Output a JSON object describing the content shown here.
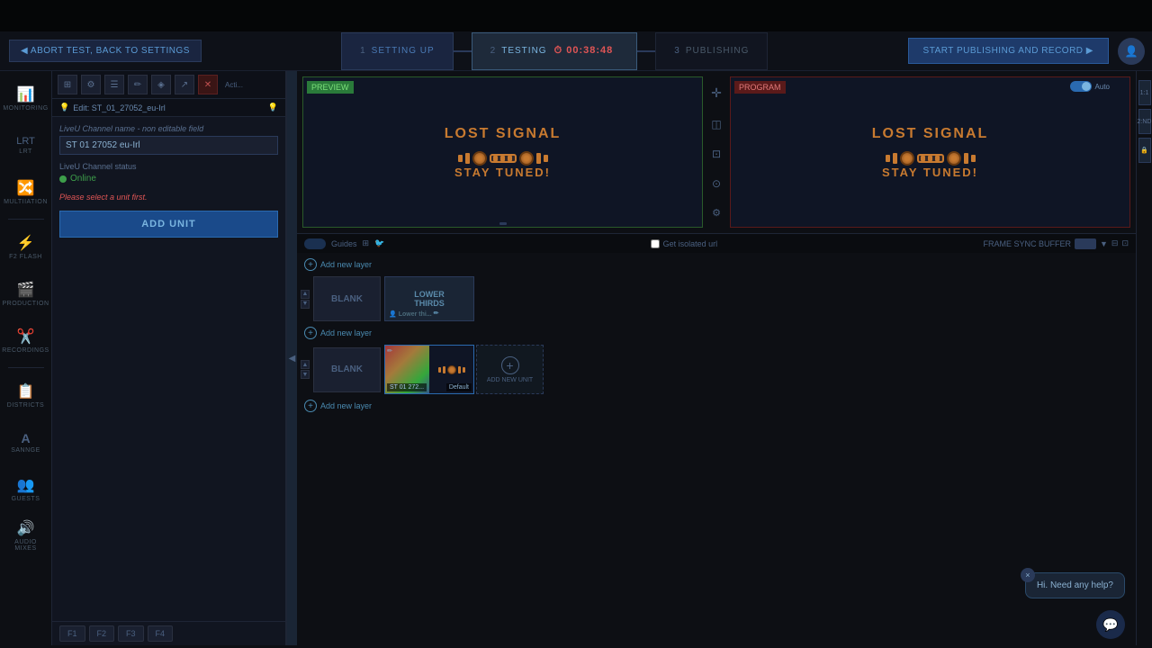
{
  "topBar": {
    "empty": ""
  },
  "header": {
    "abortBtn": "◀ ABORT TEST, BACK TO SETTINGS",
    "step1Num": "1",
    "step1Label": "SETTING UP",
    "step2Num": "2",
    "step2Label": "TESTING",
    "timer": "⏱ 00:38:48",
    "step3Num": "3",
    "step3Label": "PUBLISHING",
    "publishBtn": "START PUBLISHING AND RECORD ▶"
  },
  "sidebar": {
    "items": [
      {
        "label": "MONITORING",
        "icon": "📊"
      },
      {
        "label": "LRT",
        "icon": "📡"
      },
      {
        "label": "MULTIIATION",
        "icon": "🔀"
      },
      {
        "label": "F2 FLASH",
        "icon": "⚡"
      },
      {
        "label": "PRODUCTION",
        "icon": "🎬"
      },
      {
        "label": "RECORDINGS",
        "icon": "✂️"
      },
      {
        "label": "DISTRICTS",
        "icon": "📋"
      },
      {
        "label": "SANNGE",
        "icon": "A"
      },
      {
        "label": "GUESTS",
        "icon": "👥"
      },
      {
        "label": "AUDIO MIXES",
        "icon": "🔊"
      }
    ]
  },
  "panel": {
    "editLabel": "Edit: ST_01_27052_eu-Irl",
    "breadcrumbIcon": "💡",
    "channelNameLabel": "LiveU Channel name - non editable field",
    "channelNameValue": "ST 01 27052 eu-Irl",
    "channelStatusLabel": "LiveU Channel status",
    "statusText": "Online",
    "warningText": "Please select a unit first.",
    "addUnitBtn": "ADD UNIT",
    "tabs": [
      "F1",
      "F2",
      "F3",
      "F4"
    ]
  },
  "preview": {
    "label": "PREVIEW",
    "lostSignal": "LOST SIGNAL",
    "stayTuned": "STAY TUNED!",
    "guidesLabel": "Guides",
    "autoLabel": "Auto"
  },
  "program": {
    "label": "PROGRAM",
    "lostSignal": "LOST SIGNAL",
    "stayTuned": "STAY TUNED!",
    "isolatedUrl": "Get isolated url"
  },
  "frameSyncLabel": "FRAME SYNC BUFFER",
  "layers": {
    "layer1": {
      "addLabel": "Add new layer",
      "blankLabel": "BLANK",
      "lowerThirdsLabel": "LOWER\nTHIRDS",
      "clipTag": "Lower thi..."
    },
    "layer2": {
      "addLabel": "Add new layer",
      "blankLabel": "BLANK",
      "clipName": "ST 01 272...",
      "defaultLabel": "Default",
      "addNewLabel": "ADD NEW UNIT"
    },
    "layer3": {
      "addLabel": "Add new layer"
    }
  },
  "chat": {
    "message": "Hi. Need any help?",
    "closeLabel": "×"
  },
  "rightSidebar": {
    "btn1": "1:1",
    "btn2": "2:ND",
    "btn3": "🔒"
  }
}
